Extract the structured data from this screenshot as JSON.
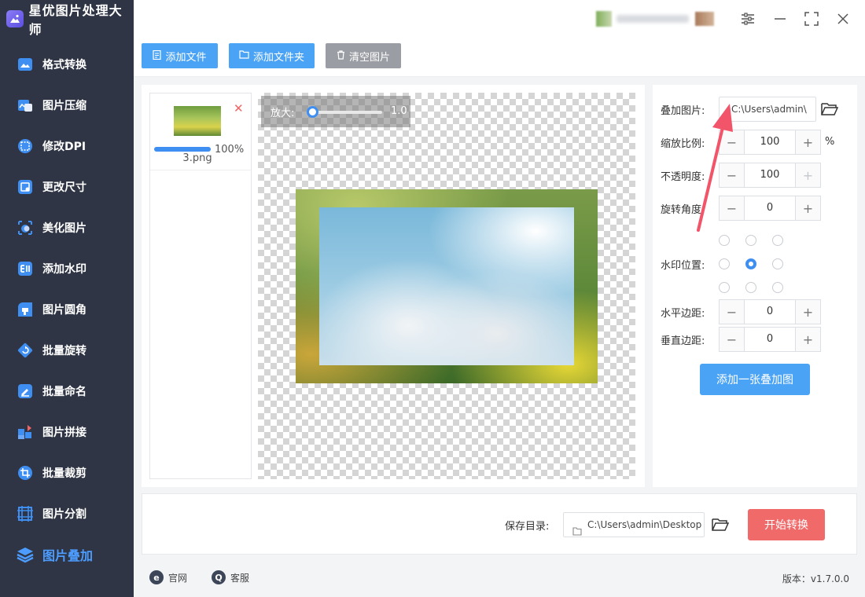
{
  "app": {
    "title": "星优图片处理大师"
  },
  "sidebar": {
    "items": [
      {
        "label": "格式转换",
        "icon": "format-convert-icon",
        "active": false
      },
      {
        "label": "图片压缩",
        "icon": "compress-icon",
        "active": false
      },
      {
        "label": "修改DPI",
        "icon": "dpi-icon",
        "active": false
      },
      {
        "label": "更改尺寸",
        "icon": "resize-icon",
        "active": false
      },
      {
        "label": "美化图片",
        "icon": "beautify-icon",
        "active": false
      },
      {
        "label": "添加水印",
        "icon": "watermark-icon",
        "active": false
      },
      {
        "label": "图片圆角",
        "icon": "round-corner-icon",
        "active": false
      },
      {
        "label": "批量旋转",
        "icon": "rotate-icon",
        "active": false
      },
      {
        "label": "批量命名",
        "icon": "rename-icon",
        "active": false
      },
      {
        "label": "图片拼接",
        "icon": "stitch-icon",
        "active": false
      },
      {
        "label": "批量裁剪",
        "icon": "crop-icon",
        "active": false
      },
      {
        "label": "图片分割",
        "icon": "split-icon",
        "active": false
      },
      {
        "label": "图片叠加",
        "icon": "overlay-icon",
        "active": true
      }
    ]
  },
  "toolbar": {
    "add_file": "添加文件",
    "add_folder": "添加文件夹",
    "clear_images": "清空图片"
  },
  "file_list": {
    "items": [
      {
        "name": "3.png",
        "progress_label": "100%",
        "progress": 1.0
      }
    ]
  },
  "preview": {
    "zoom_label": "放大:",
    "zoom_value": "1.0"
  },
  "settings": {
    "overlay_image_label": "叠加图片:",
    "overlay_image_path": "C:\\Users\\admin\\",
    "scale_label": "缩放比例:",
    "scale_value": "100",
    "scale_unit": "%",
    "opacity_label": "不透明度:",
    "opacity_value": "100",
    "rotation_label": "旋转角度:",
    "rotation_value": "0",
    "position_label": "水印位置:",
    "position_selected": "center",
    "h_margin_label": "水平边距:",
    "h_margin_value": "0",
    "v_margin_label": "垂直边距:",
    "v_margin_value": "0",
    "add_overlay_button": "添加一张叠加图",
    "minus": "−",
    "plus": "+"
  },
  "save": {
    "label": "保存目录:",
    "path": "C:\\Users\\admin\\Desktop",
    "start_button": "开始转换"
  },
  "footer": {
    "website": "官网",
    "support": "客服",
    "version": "版本：v1.7.0.0"
  },
  "colors": {
    "sidebar_bg": "#2f3544",
    "accent_blue": "#4aa3f4",
    "start_red": "#f06a6a",
    "arrow_red": "#f2556a"
  }
}
